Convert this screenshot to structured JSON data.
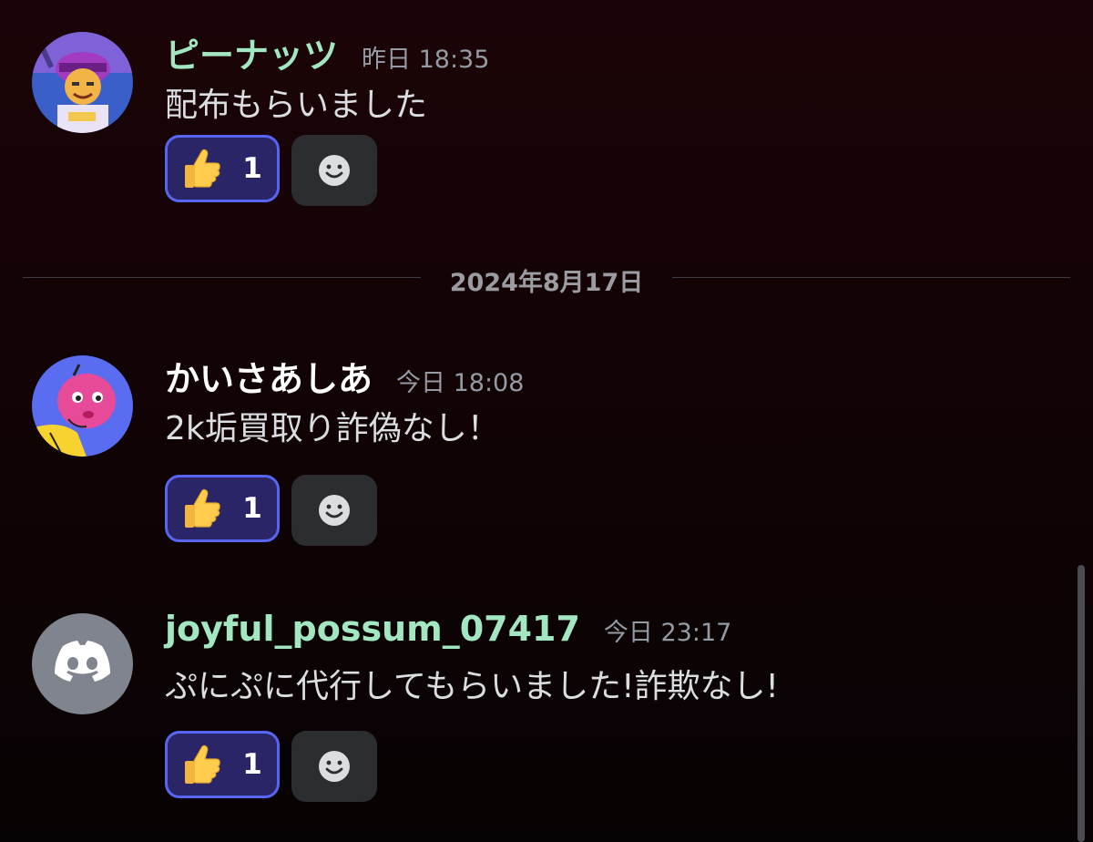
{
  "messages": [
    {
      "username": "ピーナッツ",
      "username_color": "#a3e7c0",
      "timestamp": "昨日 18:35",
      "content": "配布もらいました",
      "reaction": {
        "emoji": "thumbs-up",
        "count": "1"
      }
    },
    {
      "username": "かいさあしあ",
      "username_color": "#ffffff",
      "timestamp": "今日 18:08",
      "content": "2k垢買取り詐偽なし！",
      "reaction": {
        "emoji": "thumbs-up",
        "count": "1"
      }
    },
    {
      "username": "joyful_possum_07417",
      "username_color": "#a3e7c0",
      "timestamp": "今日 23:17",
      "content": "ぷにぷに代行してもらいました!詐欺なし!",
      "reaction": {
        "emoji": "thumbs-up",
        "count": "1"
      }
    }
  ],
  "date_divider": "2024年8月17日",
  "icons": {
    "add_reaction": "smiley-add-reaction-icon",
    "default_avatar": "discord-logo-icon"
  },
  "colors": {
    "reaction_border": "#5865f2",
    "reaction_bg": "#2a2566",
    "add_reaction_bg": "#2b2d31",
    "timestamp": "#949ba4",
    "default_avatar_bg": "#80848e"
  }
}
